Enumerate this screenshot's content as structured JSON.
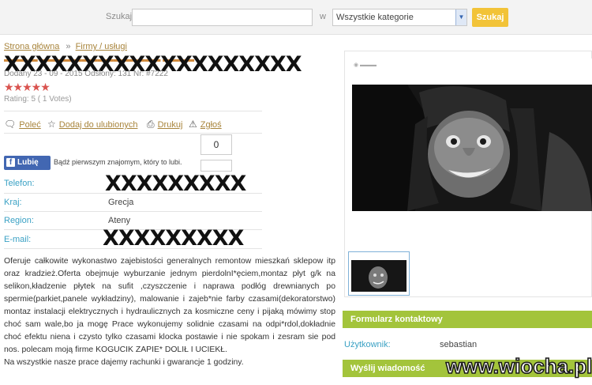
{
  "search": {
    "label": "Szukaj",
    "in_label": "w",
    "category": "Wszystkie kategorie",
    "button": "Szukaj"
  },
  "breadcrumb": {
    "home": "Strona główna",
    "separator": "»",
    "category": "Firmy / usługi"
  },
  "listing": {
    "title_censor": "XXXXXXXXXXXXXXXXXXX",
    "added": "Dodany 23 - 09 - 2015 Odsłony: 131 Nr: #7222",
    "stars": "★★★★★",
    "rating": "Rating: 5 ( 1 Votes)"
  },
  "actions": {
    "recommend": "Poleć",
    "favorites": "Dodaj do ulubionych",
    "print": "Drukuj",
    "report": "Zgłoś"
  },
  "facebook": {
    "like_label": "Lubię to!",
    "like_text": "Bądź pierwszym znajomym, który to lubi.",
    "count": "0"
  },
  "fields": {
    "phone_label": "Telefon:",
    "phone_censor": "XXXXXXXXX",
    "country_label": "Kraj:",
    "country_value": "Grecja",
    "region_label": "Region:",
    "region_value": "Ateny",
    "email_label": "E-mail:",
    "email_censor": "XXXXXXXXX"
  },
  "description": {
    "p1": "Oferuje całkowite wykonastwo zajebistości generalnych remontow mieszkań sklepow itp oraz kradzież.Oferta obejmuje wyburzanie jednym pierdolnI*ęciem,montaz płyt g/k na selikon,kładzenie płytek na sufit ,czyszczenie i naprawa podłóg drewnianych po spermie(parkiet,panele wykładziny), malowanie i zajeb*nie farby czasami(dekoratorstwo) montaz instalacji elektrycznych i hydraulicznych za kosmiczne ceny i pijaką mówimy stop choć sam wale,bo ja mogę Prace wykonujemy solidnie czasami na odpi*rdol,dokładnie choć efektu niena i czysto tylko czasami klocka postawie i nie spokam i zesram sie pod nos. polecam moją firme KOGUCIK ZAPIE* DOLIŁ I UCIEKŁ.",
    "p2": "Na wszystkie nasze prace dajemy rachunki i gwarancje 1 godziny."
  },
  "sidebar": {
    "contact_form": "Formularz kontaktowy",
    "user_label": "Użytkownik:",
    "user_value": "sebastian",
    "send_message": "Wyślij wiadomość"
  },
  "watermark": "www.wiocha.pl",
  "colors": {
    "accent_green": "#a3c43b",
    "label_blue": "#3aa1c4",
    "link_brown": "#a8843b",
    "search_button": "#f2c338",
    "facebook_blue": "#4267b2"
  }
}
